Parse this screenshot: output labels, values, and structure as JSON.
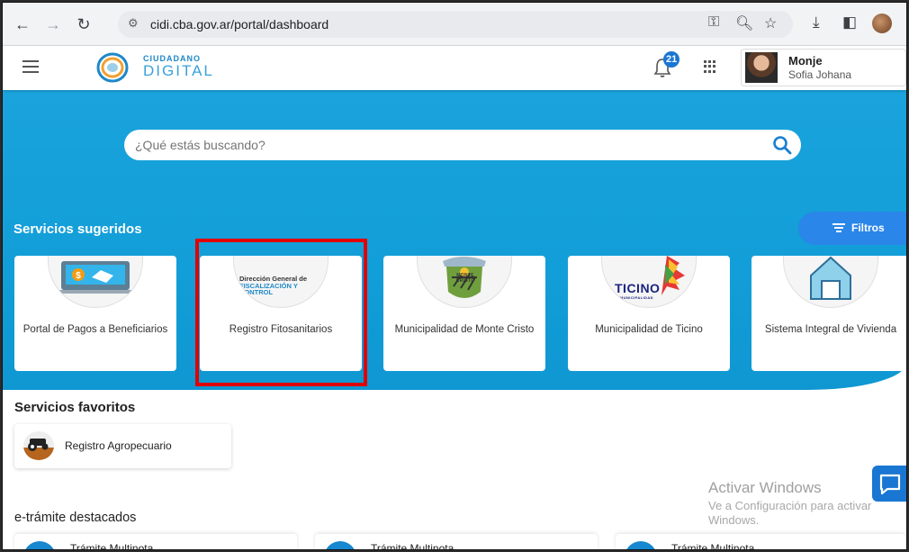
{
  "browser": {
    "url": "cidi.cba.gov.ar/portal/dashboard",
    "icons": [
      "back-icon",
      "forward-icon",
      "reload-icon",
      "site-settings-icon",
      "key-icon",
      "zoom-icon",
      "star-icon",
      "download-icon",
      "sidepanel-icon",
      "profile-icon"
    ]
  },
  "header": {
    "logo_line1": "CIUDADANO",
    "logo_line2": "DIGITAL",
    "notification_count": "21",
    "user_name": "Monje",
    "user_subname": "Sofia Johana"
  },
  "search": {
    "placeholder": "¿Qué estás buscando?"
  },
  "suggested": {
    "title": "Servicios sugeridos",
    "filters_label": "Filtros",
    "cards": [
      {
        "label": "Portal de Pagos a Beneficiarios",
        "icon": "payment-handshake-icon"
      },
      {
        "label": "Registro Fitosanitarios",
        "icon": "fiscalizacion-logo",
        "logo_line1": "Dirección General de",
        "logo_line2": "FISCALIZACIÓN Y",
        "logo_line3": "CONTROL",
        "highlighted": true
      },
      {
        "label": "Municipalidad de Monte Cristo",
        "icon": "monte-cristo-shield-icon",
        "logo_text": "MONTE CRISTO"
      },
      {
        "label": "Municipalidad de Ticino",
        "icon": "ticino-logo",
        "logo_text": "TICINO",
        "logo_sub": "MUNICIPALIDAD"
      },
      {
        "label": "Sistema Integral de Vivienda",
        "icon": "house-icon"
      }
    ]
  },
  "favorites": {
    "title": "Servicios favoritos",
    "items": [
      {
        "label": "Registro Agropecuario",
        "icon": "tractor-icon"
      }
    ]
  },
  "watermark": {
    "line1": "Activar Windows",
    "line2": "Ve a Configuración para activar",
    "line3": "Windows."
  },
  "etramites": {
    "title": "e-trámite destacados",
    "items": [
      {
        "label": "Trámite Multinota"
      },
      {
        "label": "Trámite Multinota"
      },
      {
        "label": "Trámite Multinota"
      }
    ]
  },
  "colors": {
    "hero_blue": "#129ed8",
    "button_blue": "#2a86e8",
    "highlight_red": "#e00000"
  }
}
